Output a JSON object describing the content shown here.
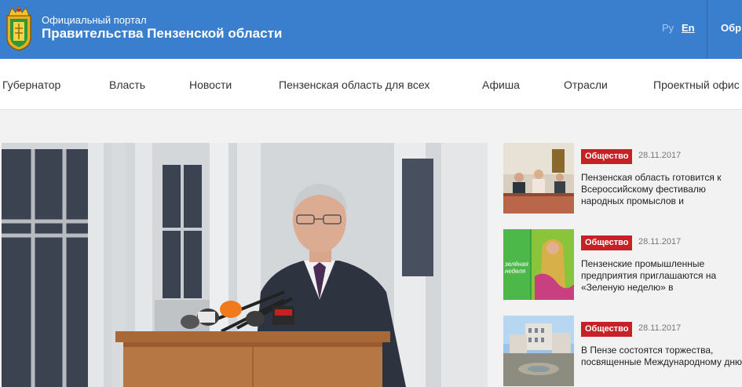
{
  "header": {
    "subtitle": "Официальный портал",
    "title": "Правительства Пензенской области",
    "lang_ru": "Ру",
    "lang_en": "En",
    "extra": "Обр"
  },
  "nav": {
    "items": [
      "Губернатор",
      "Власть",
      "Новости",
      "Пензенская область для всех",
      "Афиша",
      "Отрасли",
      "Проектный офис"
    ]
  },
  "news": [
    {
      "tag": "Общество",
      "date": "28.11.2017",
      "headline": "Пензенская область готовится к Всероссийскому фестивалю народных промыслов и"
    },
    {
      "tag": "Общество",
      "date": "28.11.2017",
      "headline": "Пензенские промышленные предприятия приглашаются на «Зеленую неделю» в"
    },
    {
      "tag": "Общество",
      "date": "28.11.2017",
      "headline": "В Пензе состоятся торжества, посвященные Международному дню"
    }
  ],
  "thumb2": {
    "text1": "зелёная",
    "text2": "неделя"
  },
  "colors": {
    "header_bg": "#3a7fcd",
    "tag_bg": "#c62127",
    "page_bg": "#f2f2f2"
  },
  "icons": {
    "logo": "coat-of-arms-icon"
  }
}
